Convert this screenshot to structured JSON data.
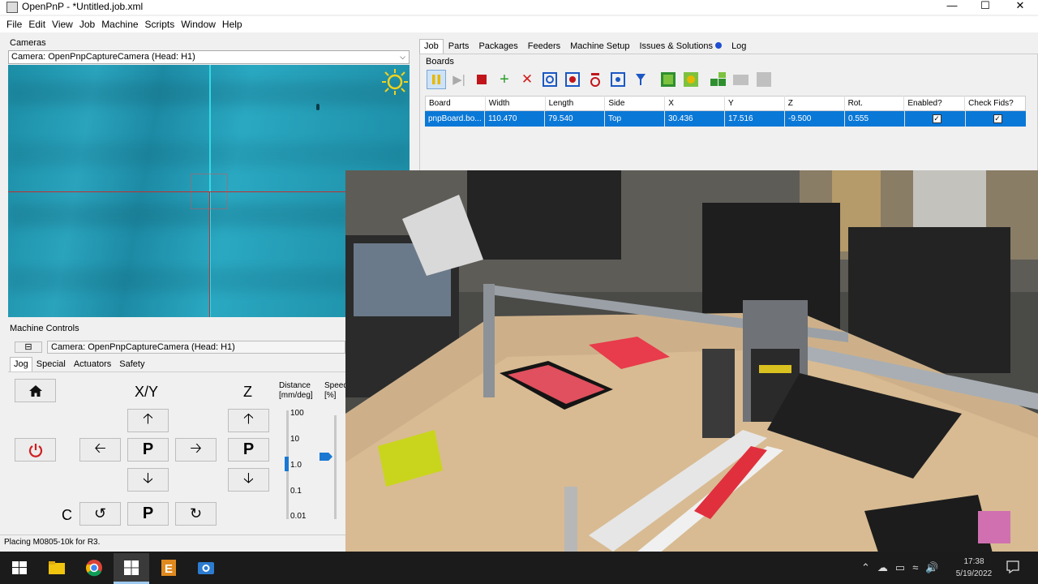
{
  "window": {
    "title": "OpenPnP - *Untitled.job.xml",
    "minimize": "—",
    "maximize": "☐",
    "close": "✕"
  },
  "menu": [
    "File",
    "Edit",
    "View",
    "Job",
    "Machine",
    "Scripts",
    "Window",
    "Help"
  ],
  "cameras": {
    "section_label": "Cameras",
    "selected": "Camera: OpenPnpCaptureCamera (Head: H1)"
  },
  "machine_controls": {
    "section_label": "Machine Controls",
    "camera": "Camera: OpenPnpCaptureCamera (Head: H1)",
    "tabs": [
      "Jog",
      "Special",
      "Actuators",
      "Safety"
    ],
    "xy_label": "X/Y",
    "z_label": "Z",
    "c_label": "C",
    "park": "P",
    "distance_label": "Distance",
    "distance_unit": "[mm/deg]",
    "speed_label": "Speed",
    "speed_unit": "[%]",
    "distance_ticks": [
      "100",
      "10",
      "1.0",
      "0.1",
      "0.01"
    ],
    "distance_value": "1.0"
  },
  "status": "Placing M0805-10k for R3.",
  "right_tabs": [
    "Job",
    "Parts",
    "Packages",
    "Feeders",
    "Machine Setup",
    "Issues & Solutions",
    "Log"
  ],
  "boards": {
    "section_label": "Boards",
    "columns": [
      "Board",
      "Width",
      "Length",
      "Side",
      "X",
      "Y",
      "Z",
      "Rot.",
      "Enabled?",
      "Check Fids?"
    ],
    "rows": [
      {
        "board": "pnpBoard.bo...",
        "width": "110.470",
        "length": "79.540",
        "side": "Top",
        "x": "30.436",
        "y": "17.516",
        "z": "-9.500",
        "rot": "0.555",
        "enabled": true,
        "check_fids": true
      }
    ]
  },
  "taskbar": {
    "time": "17:38",
    "date": "5/19/2022"
  },
  "colors": {
    "selection": "#0a78d7",
    "crosshair": "#e03030",
    "camera_cross_v": "#35d9e6",
    "stop_red": "#c0161b"
  }
}
